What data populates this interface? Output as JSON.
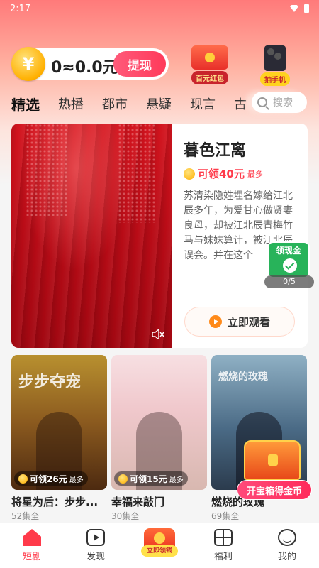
{
  "status_bar": {
    "time": "2:17"
  },
  "header": {
    "coin_symbol": "¥",
    "balance": "0≈0.0元",
    "withdraw_label": "提现",
    "promos": [
      {
        "label": "百元红包",
        "icon": "red-packet-icon"
      },
      {
        "label": "抽手机",
        "icon": "phone-icon"
      }
    ]
  },
  "tabs": {
    "items": [
      "精选",
      "热播",
      "都市",
      "悬疑",
      "现言",
      "古"
    ],
    "active_index": 0
  },
  "search": {
    "placeholder": "搜索"
  },
  "featured": {
    "title": "暮色江离",
    "reward": "可领40元",
    "reward_max": "最多",
    "description": "苏清染隐姓埋名嫁给江北辰多年，为爱甘心做贤妻良母，却被江北辰青梅竹马与妹妹算计，被江北辰误会。并在这个",
    "watch_label": "立即观看"
  },
  "cash_float": {
    "title": "领现金",
    "progress": "0/5"
  },
  "dramas": [
    {
      "title": "将星为后：步步...",
      "episodes": "52集全",
      "reward": "可领26元",
      "reward_max": "最多",
      "poster_text": "步步夺宠"
    },
    {
      "title": "幸福来敲门",
      "episodes": "30集全",
      "reward": "可领15元",
      "reward_max": "最多",
      "poster_text": ""
    },
    {
      "title": "燃烧的玫瑰",
      "episodes": "69集全",
      "reward": "",
      "reward_max": "",
      "poster_text": "燃烧的玫瑰"
    }
  ],
  "treasure": {
    "label": "开宝箱得金币"
  },
  "bottom_nav": {
    "items": [
      {
        "label": "短剧",
        "icon": "home-icon"
      },
      {
        "label": "发现",
        "icon": "play-box-icon"
      },
      {
        "label": "立即领钱",
        "icon": "red-packet-icon"
      },
      {
        "label": "福利",
        "icon": "gift-icon"
      },
      {
        "label": "我的",
        "icon": "profile-icon"
      }
    ],
    "active_index": 0
  },
  "colors": {
    "accent": "#ff3a4a",
    "top_gradient": "#ff7a7a",
    "cash_green": "#28b35a"
  }
}
